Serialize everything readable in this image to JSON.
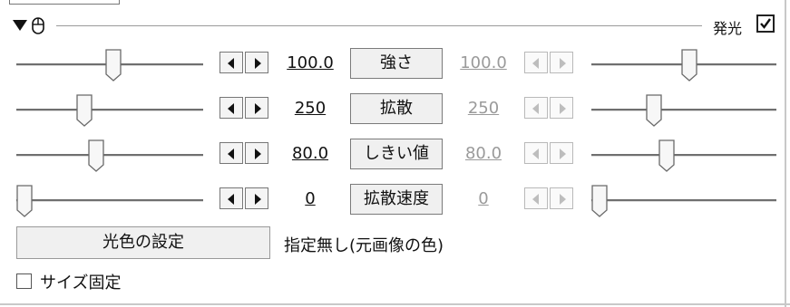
{
  "header": {
    "collapse_icon": "triangle-down-icon",
    "mouse_icon": "mouse-icon",
    "effect_label": "発光",
    "enabled": true
  },
  "params": [
    {
      "name": "強さ",
      "left_value": "100.0",
      "right_value": "100.0",
      "left_level": 0.52,
      "right_level": 0.53
    },
    {
      "name": "拡散",
      "left_value": "250",
      "right_value": "250",
      "left_level": 0.35,
      "right_level": 0.32
    },
    {
      "name": "しきい値",
      "left_value": "80.0",
      "right_value": "80.0",
      "left_level": 0.42,
      "right_level": 0.4
    },
    {
      "name": "拡散速度",
      "left_value": "0",
      "right_value": "0",
      "left_level": 0.0,
      "right_level": 0.0
    }
  ],
  "color_button": "光色の設定",
  "color_status": "指定無し(元画像の色)",
  "size_fixed": {
    "label": "サイズ固定",
    "checked": false
  },
  "colors": {
    "track": "#6f6f6f",
    "disabled_text": "#9a9a9a",
    "button_face": "#f0f0f0"
  }
}
